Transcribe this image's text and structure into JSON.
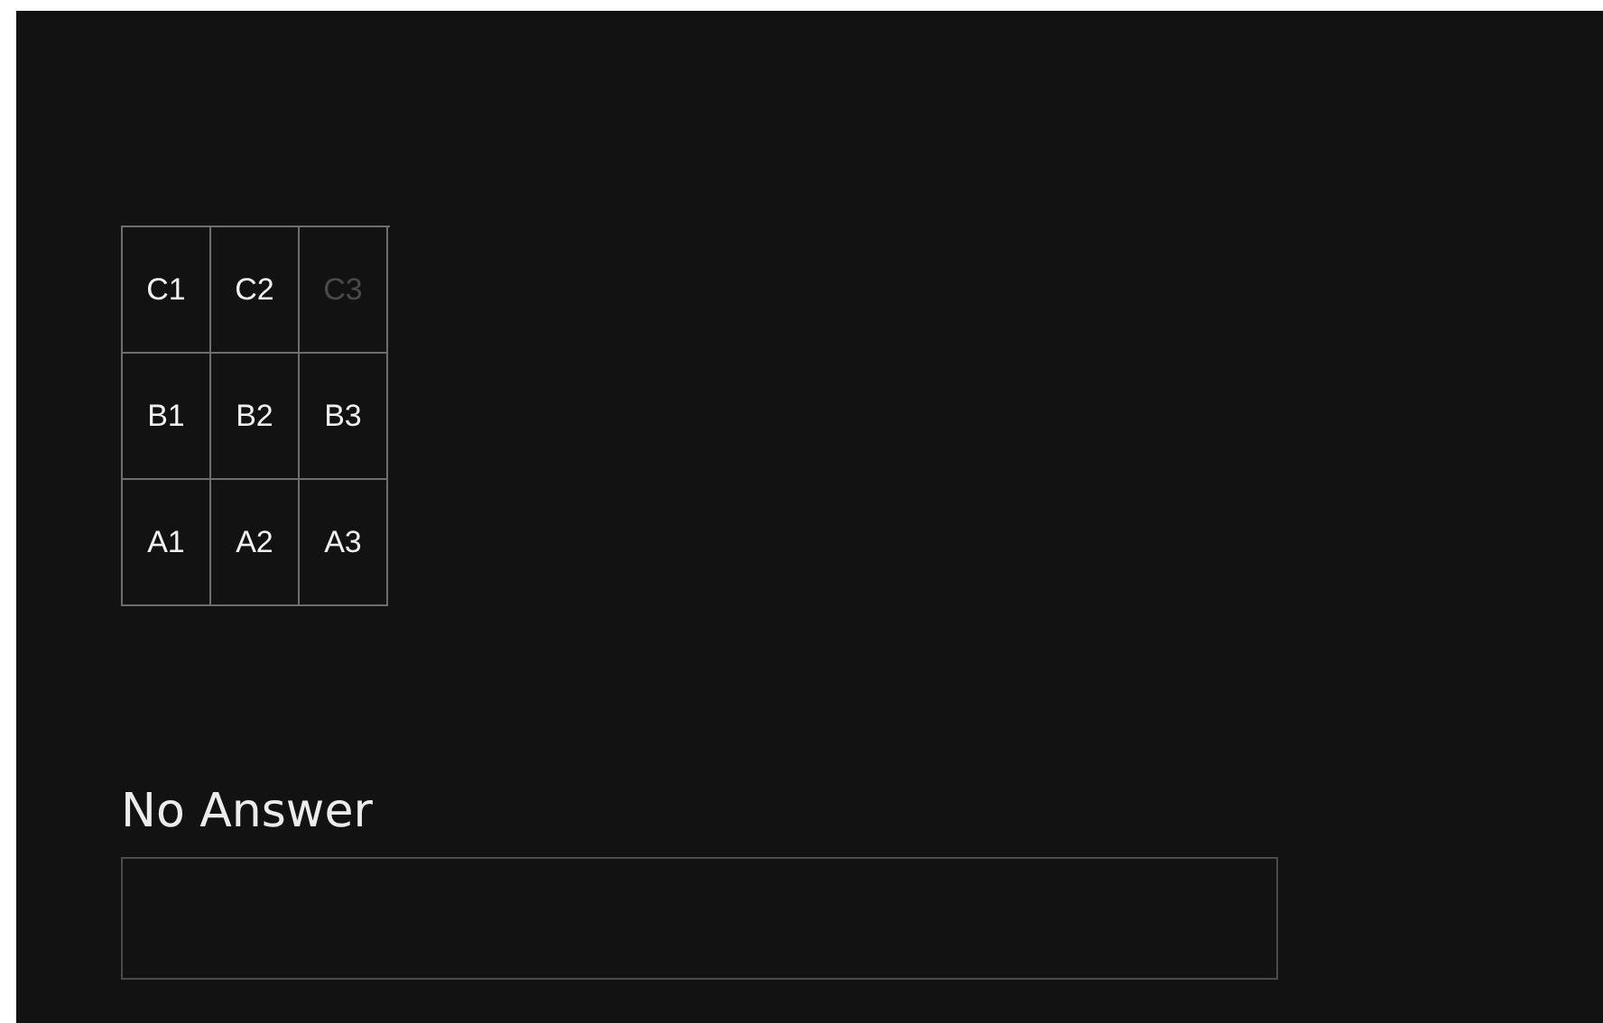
{
  "grid": {
    "rows": [
      [
        {
          "label": "C1",
          "disabled": false
        },
        {
          "label": "C2",
          "disabled": false
        },
        {
          "label": "C3",
          "disabled": true
        }
      ],
      [
        {
          "label": "B1",
          "disabled": false
        },
        {
          "label": "B2",
          "disabled": false
        },
        {
          "label": "B3",
          "disabled": false
        }
      ],
      [
        {
          "label": "A1",
          "disabled": false
        },
        {
          "label": "A2",
          "disabled": false
        },
        {
          "label": "A3",
          "disabled": false
        }
      ]
    ]
  },
  "answer": {
    "heading": "No Answer"
  }
}
